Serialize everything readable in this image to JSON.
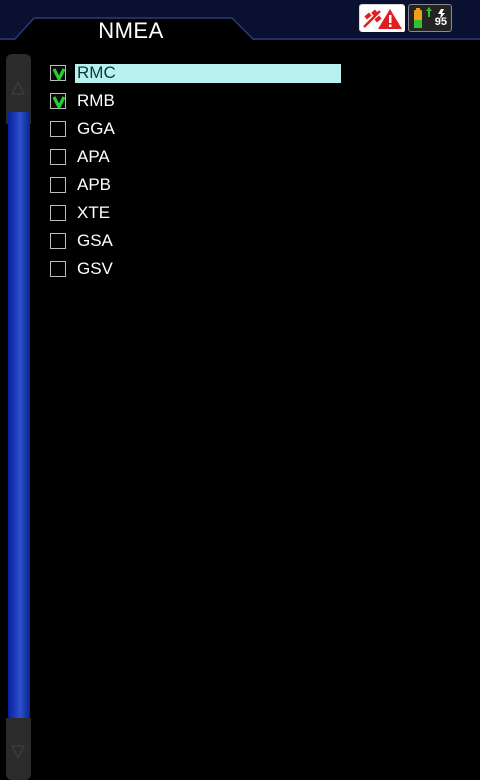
{
  "header": {
    "title": "NMEA"
  },
  "status": {
    "alarm_icon": "gps-alarm-warning-icon",
    "battery_icon": "battery-charging-icon",
    "battery_percent": "95"
  },
  "list": {
    "items": [
      {
        "label": "RMC",
        "checked": true,
        "selected": true
      },
      {
        "label": "RMB",
        "checked": true,
        "selected": false
      },
      {
        "label": "GGA",
        "checked": false,
        "selected": false
      },
      {
        "label": "APA",
        "checked": false,
        "selected": false
      },
      {
        "label": "APB",
        "checked": false,
        "selected": false
      },
      {
        "label": "XTE",
        "checked": false,
        "selected": false
      },
      {
        "label": "GSA",
        "checked": false,
        "selected": false
      },
      {
        "label": "GSV",
        "checked": false,
        "selected": false
      }
    ]
  },
  "colors": {
    "check_green": "#22d22e",
    "selection_cyan": "#b9f0f0",
    "scroll_blue": "#1f3fb8",
    "alarm_red": "#e02020"
  }
}
